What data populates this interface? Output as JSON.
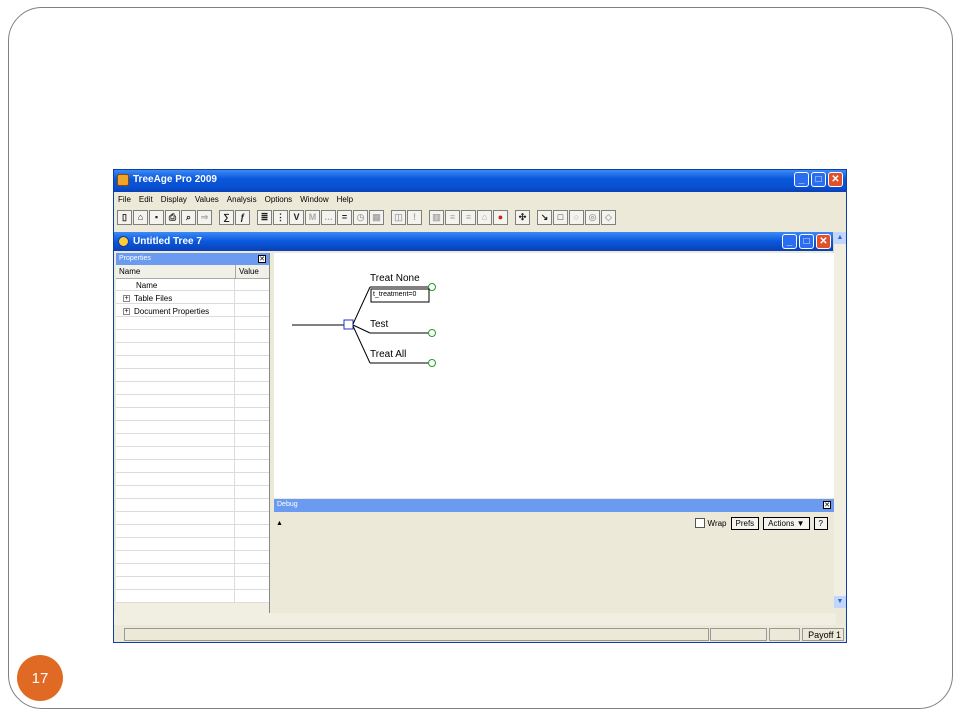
{
  "slide": {
    "page_number": "17"
  },
  "app": {
    "title": "TreeAge Pro 2009",
    "menu": [
      "File",
      "Edit",
      "Display",
      "Values",
      "Analysis",
      "Options",
      "Window",
      "Help"
    ],
    "toolbar_icons": [
      "new-doc-icon",
      "open-icon",
      "save-icon",
      "print-icon",
      "print-preview-icon",
      "export-icon",
      "variables-icon",
      "function-icon",
      "tree-props-icon",
      "variable-def-icon",
      "value-icon",
      "markov-icon",
      "dots-icon",
      "equals-icon",
      "clock-icon",
      "calculator-icon",
      "book-icon",
      "warning-icon",
      "bar-chart-icon",
      "sens-1way-icon",
      "sens-2way-icon",
      "home-icon",
      "color-icon",
      "move-icon",
      "arrow-icon",
      "square-node-icon",
      "circle-node-icon",
      "terminal-node-icon",
      "diamond-node-icon"
    ],
    "accent_color": "#0a58dc"
  },
  "document": {
    "title": "Untitled Tree 7"
  },
  "properties": {
    "title": "Properties",
    "columns": [
      "Name",
      "Value"
    ],
    "rows": [
      {
        "label": "Name",
        "expandable": false
      },
      {
        "label": "Table Files",
        "expandable": true
      },
      {
        "label": "Document Properties",
        "expandable": true
      }
    ]
  },
  "tree": {
    "branches": [
      "Treat None",
      "Test",
      "Treat All"
    ],
    "branch_annotation": "t_treatment=0"
  },
  "debug": {
    "title": "Debug",
    "wrap_label": "Wrap",
    "prefs_label": "Prefs",
    "actions_label": "Actions ▼",
    "help_label": "?"
  },
  "status_bar": {
    "right_label": "Payoff 1"
  }
}
